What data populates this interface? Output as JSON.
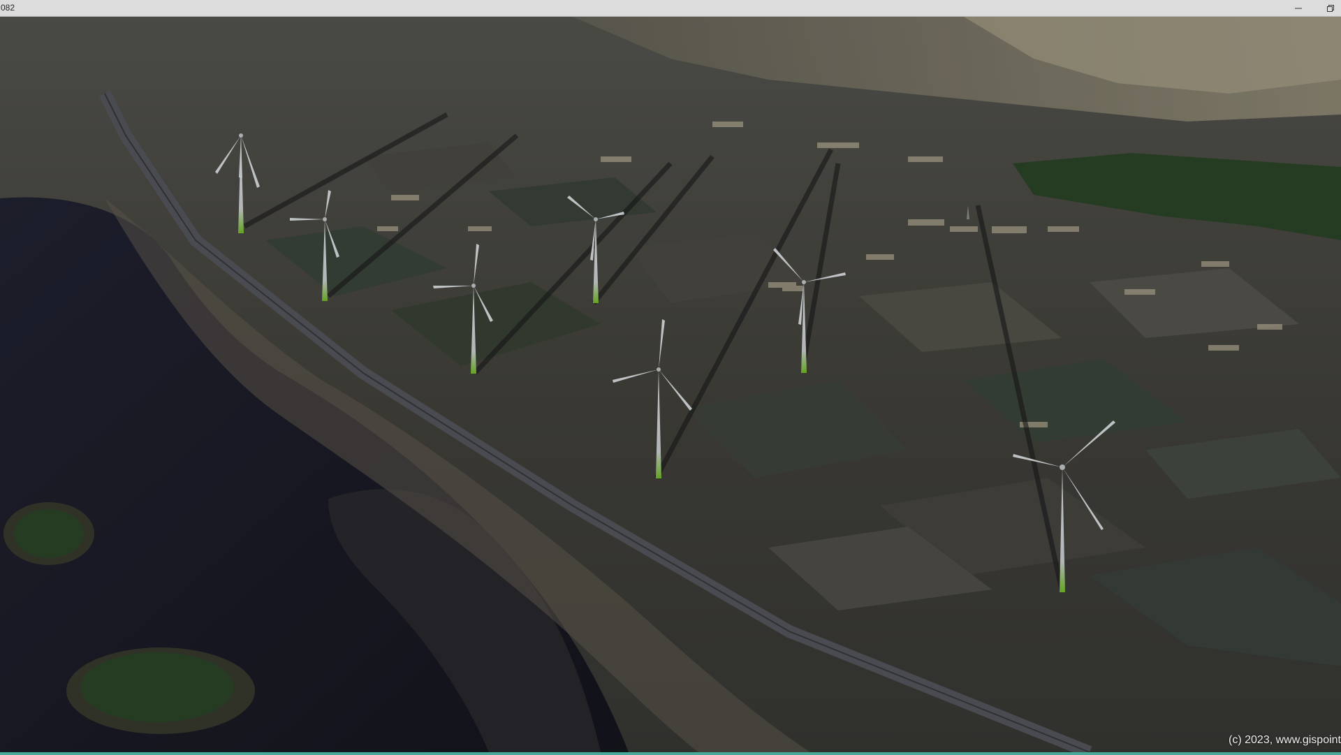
{
  "window": {
    "title": "082",
    "buttons": {
      "minimize": "minimize-icon",
      "restore": "restore-icon"
    }
  },
  "viewport": {
    "copyright": "(c) 2023, www.gispoint"
  },
  "scene": {
    "turbine_count": 8,
    "colors": {
      "water": "#1c1d2b",
      "land": "#4a4940",
      "field_dark": "#3f4640",
      "field_light": "#5a5851",
      "road": "#52545a",
      "buildings": "#b9b198",
      "trees": "#2f4a2a",
      "turbine": "#e6ebee",
      "turbine_base": "#7bc92c",
      "accent_border": "#49a99a"
    }
  }
}
